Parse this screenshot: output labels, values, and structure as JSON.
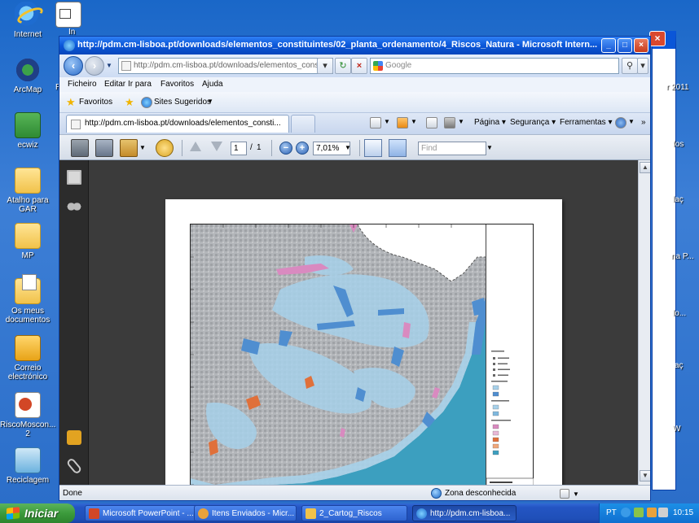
{
  "desktop": {
    "icons": [
      {
        "label": "Internet",
        "name": "internet-icon"
      },
      {
        "label": "ArcMap",
        "name": "arcmap-icon"
      },
      {
        "label": "ecwiz",
        "name": "ecwiz-icon"
      },
      {
        "label": "Atalho para GAR",
        "name": "folder-gar-icon"
      },
      {
        "label": "MP",
        "name": "folder-mp-icon"
      },
      {
        "label": "Os meus documentos",
        "name": "my-documents-icon"
      },
      {
        "label": "Correio electrónico",
        "name": "email-icon"
      },
      {
        "label": "RiscoMoscon... 2",
        "name": "powerpoint-file-icon"
      },
      {
        "label": "Reciclagem",
        "name": "recycle-bin-icon"
      }
    ],
    "right_labels": [
      "r 2011",
      "fos",
      "laç",
      "na P...",
      "lo...",
      "aç",
      "W"
    ],
    "partial_left": [
      "In",
      "R"
    ]
  },
  "window": {
    "title": "http://pdm.cm-lisboa.pt/downloads/elementos_constituintes/02_planta_ordenamento/4_Riscos_Natura - Microsoft Intern...",
    "address": "http://pdm.cm-lisboa.pt/downloads/elementos_constitu",
    "search_placeholder": "Google",
    "menu": [
      "Ficheiro",
      "Editar",
      "Ir para",
      "Favoritos",
      "Ajuda"
    ],
    "favorites_label": "Favoritos",
    "suggested_sites": "Sites Sugeridos",
    "tab_title": "http://pdm.cm-lisboa.pt/downloads/elementos_consti...",
    "commands": {
      "page": "Página",
      "security": "Segurança",
      "tools": "Ferramentas"
    }
  },
  "pdf": {
    "current_page": "1",
    "page_sep": "/",
    "total_pages": "1",
    "zoom": "7,01%",
    "find_placeholder": "Find"
  },
  "status": {
    "left": "Done",
    "zone": "Zona desconhecida"
  },
  "taskbar": {
    "start": "Iniciar",
    "tasks": [
      {
        "label": "Microsoft PowerPoint - ...",
        "color": "#d24726"
      },
      {
        "label": "Itens Enviados - Micr...",
        "color": "#e9a23b"
      },
      {
        "label": "2_Cartog_Riscos",
        "color": "#f1c24a"
      },
      {
        "label": "http://pdm.cm-lisboa...",
        "color": "#1e6cd0"
      }
    ],
    "lang": "PT",
    "clock": "10:15"
  },
  "colors": {
    "map_land": "#a9acb0",
    "map_water": "#3c9fbf",
    "map_risk_light": "#a7d1ea",
    "map_risk_blue": "#4f8ed0",
    "map_risk_pink": "#d98ac0",
    "map_risk_orange": "#e0703a"
  }
}
